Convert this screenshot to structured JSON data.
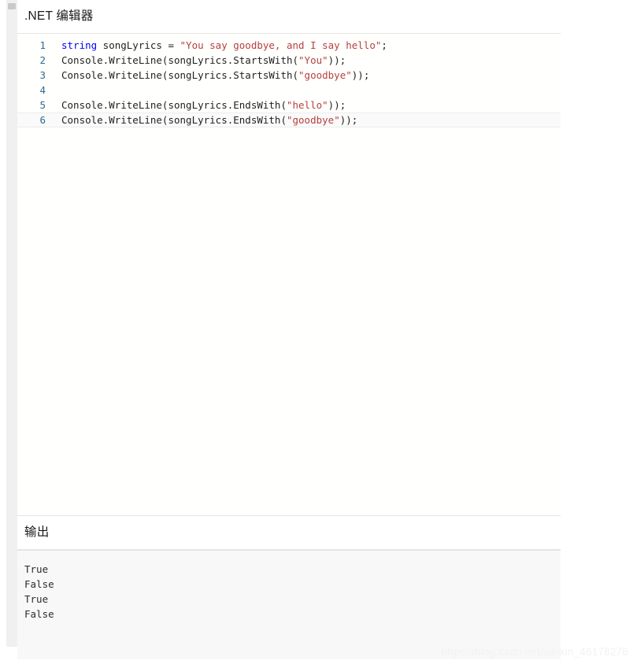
{
  "editor": {
    "title": ".NET 编辑器",
    "lines": [
      {
        "number": "1",
        "tokens": [
          {
            "t": "string",
            "c": "kw"
          },
          {
            "t": " songLyrics = ",
            "c": "plain"
          },
          {
            "t": "\"You say goodbye, and I say hello\"",
            "c": "str"
          },
          {
            "t": ";",
            "c": "plain"
          }
        ],
        "active": false
      },
      {
        "number": "2",
        "tokens": [
          {
            "t": "Console.WriteLine(songLyrics.StartsWith(",
            "c": "plain"
          },
          {
            "t": "\"You\"",
            "c": "str"
          },
          {
            "t": "));",
            "c": "plain"
          }
        ],
        "active": false
      },
      {
        "number": "3",
        "tokens": [
          {
            "t": "Console.WriteLine(songLyrics.StartsWith(",
            "c": "plain"
          },
          {
            "t": "\"goodbye\"",
            "c": "str"
          },
          {
            "t": "));",
            "c": "plain"
          }
        ],
        "active": false
      },
      {
        "number": "4",
        "tokens": [],
        "active": false
      },
      {
        "number": "5",
        "tokens": [
          {
            "t": "Console.WriteLine(songLyrics.EndsWith(",
            "c": "plain"
          },
          {
            "t": "\"hello\"",
            "c": "str"
          },
          {
            "t": "));",
            "c": "plain"
          }
        ],
        "active": false
      },
      {
        "number": "6",
        "tokens": [
          {
            "t": "Console.WriteLine(songLyrics.EndsWith(",
            "c": "plain"
          },
          {
            "t": "\"goodbye\"",
            "c": "str"
          },
          {
            "t": "));",
            "c": "plain"
          }
        ],
        "active": true
      }
    ]
  },
  "output": {
    "title": "输出",
    "lines": [
      "True",
      "False",
      "True",
      "False"
    ]
  },
  "watermark": {
    "text": "https://blog.csdn.net/weixin_46178278"
  },
  "colors": {
    "keyword": "#0000ff",
    "string": "#b5413f",
    "line_number": "#2f6b8f",
    "text": "#1f1f1f",
    "output_bg": "#f8f8f8",
    "divider": "#e4e4e4"
  }
}
